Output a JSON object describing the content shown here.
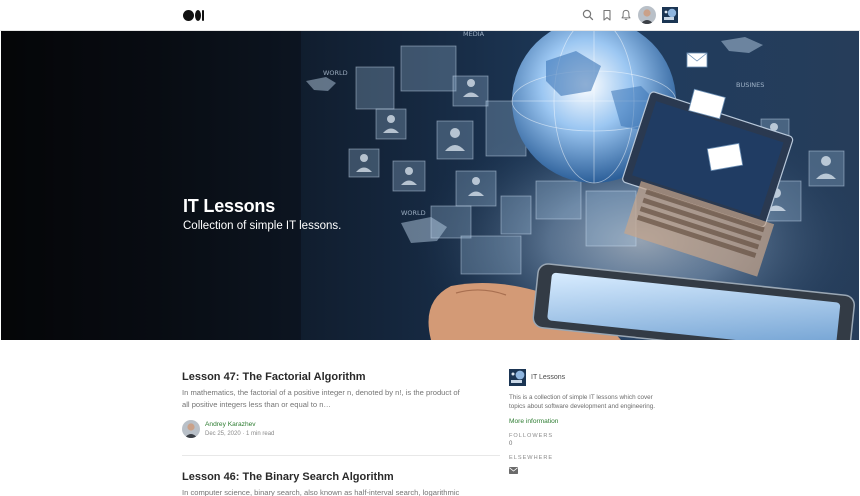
{
  "header": {
    "logo_icon": "medium-logo",
    "icons": [
      "search-icon",
      "bookmark-icon",
      "bell-icon"
    ],
    "accent": "#1a8917"
  },
  "hero": {
    "title": "IT Lessons",
    "subtitle": "Collection of simple IT lessons."
  },
  "articles": [
    {
      "title": "Lesson 47: The Factorial Algorithm",
      "excerpt_line1": "In mathematics, the factorial of a positive integer n, denoted by n!, is the product of",
      "excerpt_line2": "all positive integers less than or equal to n…",
      "author": "Andrey Karazhev",
      "meta": "Dec 25, 2020 · 1 min read"
    },
    {
      "title": "Lesson 46: The Binary Search Algorithm",
      "excerpt_line1": "In computer science, binary search, also known as half-interval search, logarithmic"
    }
  ],
  "sidebar": {
    "pub_name": "IT Lessons",
    "description": "This is a collection of simple IT lessons which cover topics about software development and engineering.",
    "more_info": "More information",
    "followers_label": "FOLLOWERS",
    "followers_count": "0",
    "elsewhere_label": "ELSEWHERE",
    "elsewhere_icon": "mail-icon"
  }
}
